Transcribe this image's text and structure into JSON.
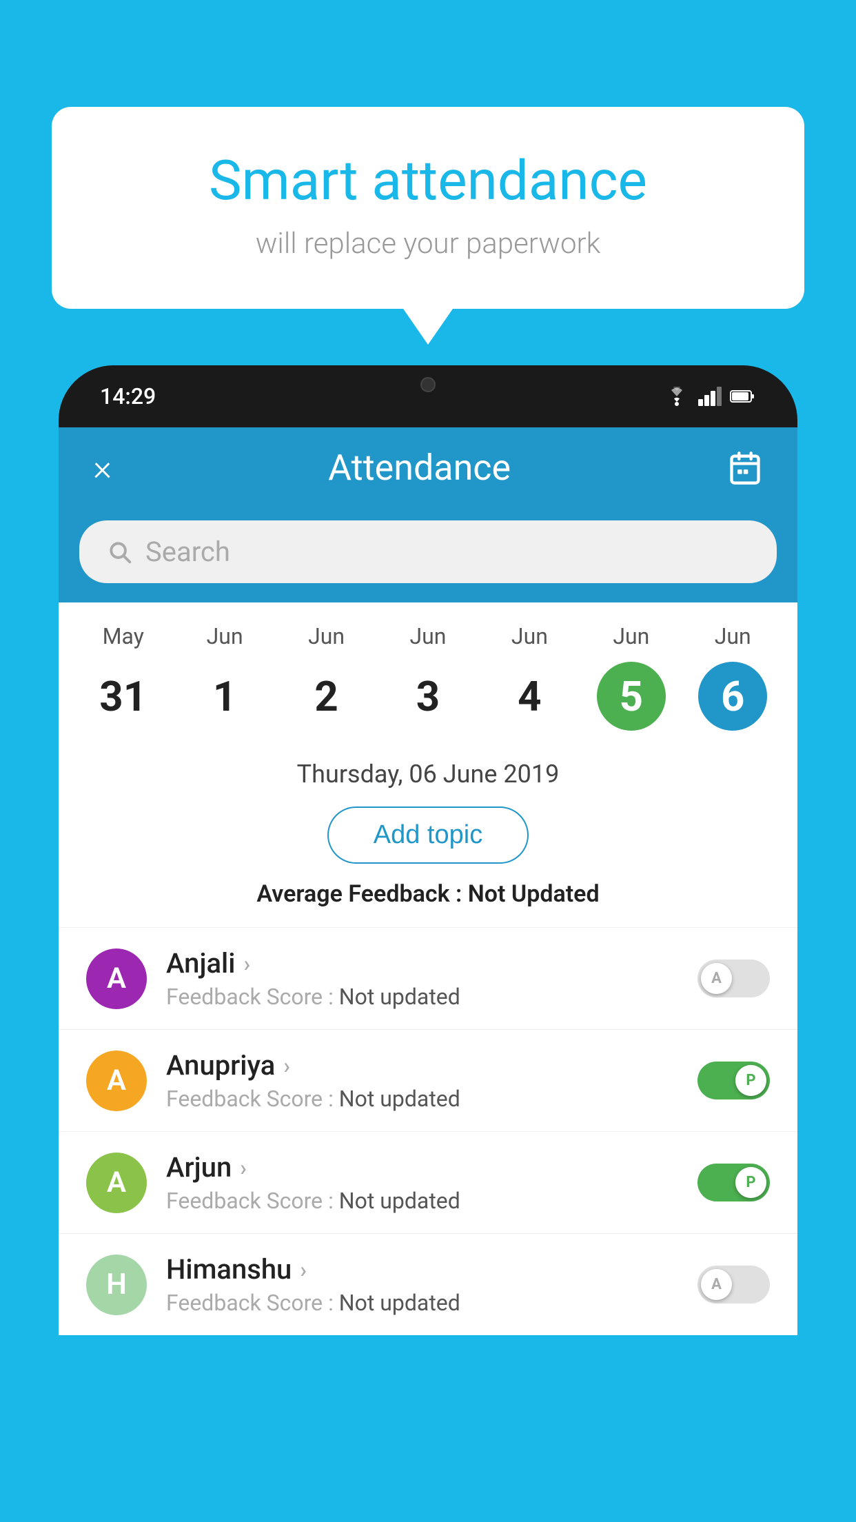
{
  "background_color": "#1ab8e8",
  "speech_bubble": {
    "title": "Smart attendance",
    "subtitle": "will replace your paperwork"
  },
  "phone": {
    "status_bar": {
      "time": "14:29",
      "icons": [
        "wifi",
        "signal",
        "battery"
      ]
    },
    "app": {
      "header": {
        "close_label": "×",
        "title": "Attendance",
        "calendar_icon": "📅"
      },
      "search": {
        "placeholder": "Search"
      },
      "calendar": {
        "days": [
          {
            "month": "May",
            "date": "31",
            "state": "normal"
          },
          {
            "month": "Jun",
            "date": "1",
            "state": "normal"
          },
          {
            "month": "Jun",
            "date": "2",
            "state": "normal"
          },
          {
            "month": "Jun",
            "date": "3",
            "state": "normal"
          },
          {
            "month": "Jun",
            "date": "4",
            "state": "normal"
          },
          {
            "month": "Jun",
            "date": "5",
            "state": "today"
          },
          {
            "month": "Jun",
            "date": "6",
            "state": "selected"
          }
        ]
      },
      "selected_date": "Thursday, 06 June 2019",
      "add_topic_label": "Add topic",
      "avg_feedback_label": "Average Feedback : ",
      "avg_feedback_value": "Not Updated",
      "students": [
        {
          "name": "Anjali",
          "initial": "A",
          "avatar_color": "#9c27b0",
          "feedback_label": "Feedback Score : ",
          "feedback_value": "Not updated",
          "toggle_state": "off",
          "toggle_letter": "A"
        },
        {
          "name": "Anupriya",
          "initial": "A",
          "avatar_color": "#f5a623",
          "feedback_label": "Feedback Score : ",
          "feedback_value": "Not updated",
          "toggle_state": "on",
          "toggle_letter": "P"
        },
        {
          "name": "Arjun",
          "initial": "A",
          "avatar_color": "#8bc34a",
          "feedback_label": "Feedback Score : ",
          "feedback_value": "Not updated",
          "toggle_state": "on",
          "toggle_letter": "P"
        },
        {
          "name": "Himanshu",
          "initial": "H",
          "avatar_color": "#a5d6a7",
          "feedback_label": "Feedback Score : ",
          "feedback_value": "Not updated",
          "toggle_state": "off",
          "toggle_letter": "A"
        }
      ]
    }
  }
}
